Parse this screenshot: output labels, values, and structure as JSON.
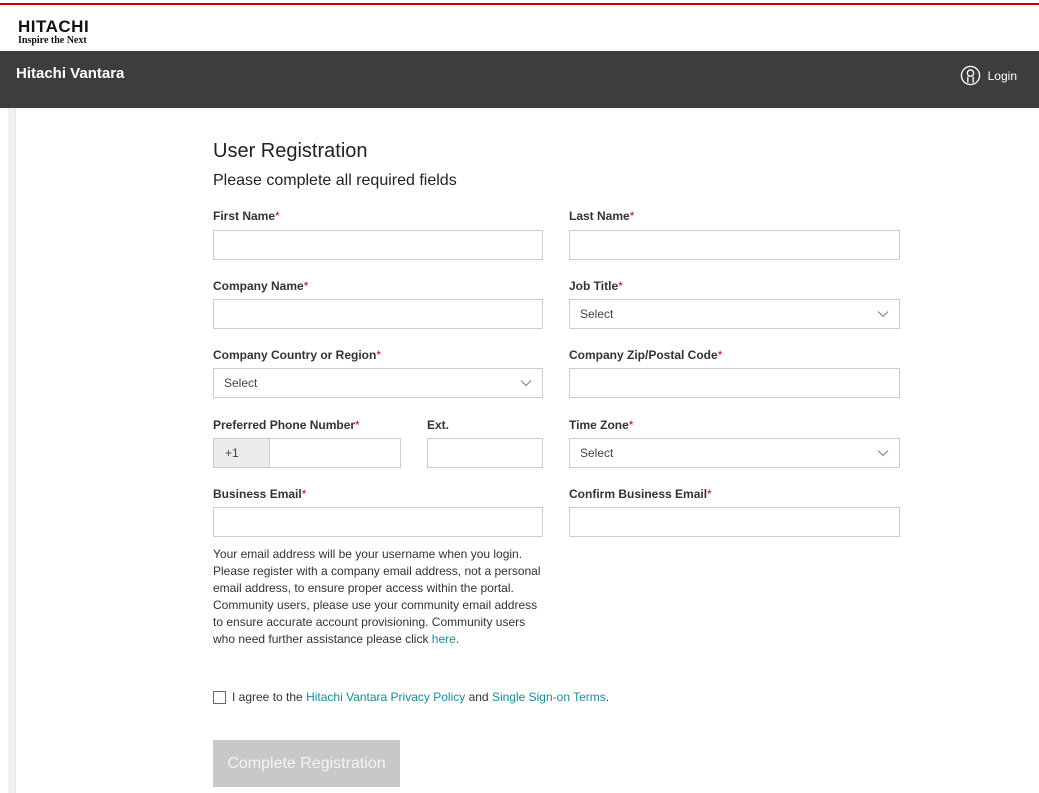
{
  "brand": {
    "word": "HITACHI",
    "tagline": "Inspire the Next"
  },
  "navbar": {
    "title": "Hitachi Vantara",
    "login_label": "Login"
  },
  "form": {
    "title": "User Registration",
    "subtitle": "Please complete all required fields",
    "required_mark": "*",
    "fields": {
      "first_name": {
        "label": "First Name",
        "value": ""
      },
      "last_name": {
        "label": "Last Name",
        "value": ""
      },
      "company_name": {
        "label": "Company Name",
        "value": ""
      },
      "job_title": {
        "label": "Job Title",
        "selected": "Select"
      },
      "country": {
        "label": "Company Country or Region",
        "selected": "Select"
      },
      "zip": {
        "label": "Company Zip/Postal Code",
        "value": ""
      },
      "phone": {
        "label": "Preferred Phone Number",
        "prefix": "+1",
        "value": ""
      },
      "ext": {
        "label": "Ext.",
        "value": ""
      },
      "time_zone": {
        "label": "Time Zone",
        "selected": "Select"
      },
      "email": {
        "label": "Business Email",
        "value": ""
      },
      "confirm_email": {
        "label": "Confirm Business Email",
        "value": ""
      }
    },
    "note": {
      "text": "Your email address will be your username when you login. Please register with a company email address, not a personal email address, to ensure proper access within the portal. Community users, please use your community email address to ensure accurate account provisioning. Community users who need further assistance please click ",
      "link": "here",
      "end": "."
    },
    "agree": {
      "prefix": "I agree to the ",
      "privacy_link": "Hitachi Vantara Privacy Policy",
      "middle": " and ",
      "terms_link": "Single Sign-on Terms",
      "suffix": ".",
      "checked": false
    },
    "submit_label": "Complete Registration"
  },
  "icons": {
    "login": "user-circle-icon",
    "dropdown": "chevron-down-icon"
  },
  "colors": {
    "brand_red": "#cc0000",
    "navbar_bg": "#3d3d3d",
    "link": "#1a8a96",
    "required": "#cc0000",
    "button_disabled": "#c8c8c8"
  }
}
